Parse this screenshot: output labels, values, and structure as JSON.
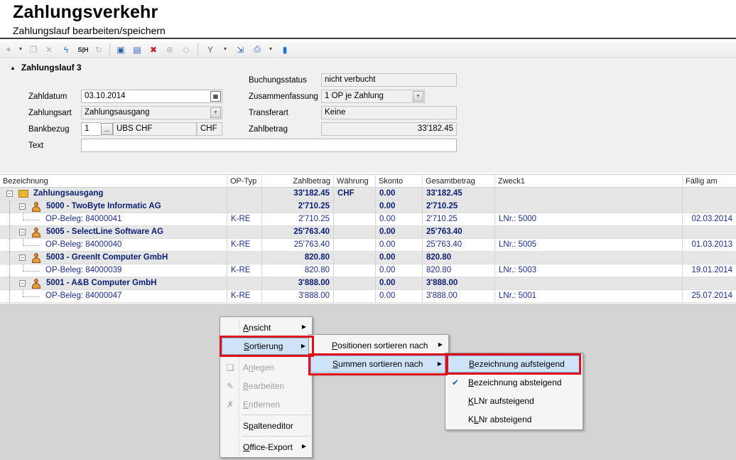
{
  "app": {
    "title": "Zahlungsverkehr",
    "subtitle": "Zahlungslauf bearbeiten/speichern"
  },
  "toolbar": {
    "icons": [
      "wand-icon",
      "copy-icon",
      "delete-icon",
      "lightning-icon",
      "sh-icon",
      "refresh-icon",
      "new-icon",
      "edit-icon",
      "remove-icon",
      "add-icon",
      "eraser-icon",
      "filter-icon",
      "export-icon",
      "print-icon",
      "save-icon"
    ],
    "sh_label": "S|H"
  },
  "section": {
    "title": "Zahlungslauf 3"
  },
  "form": {
    "zahldatum": {
      "label": "Zahldatum",
      "value": "03.10.2014"
    },
    "zahlungsart": {
      "label": "Zahlungsart",
      "value": "Zahlungsausgang"
    },
    "bankbezug": {
      "label": "Bankbezug",
      "value": "1",
      "bank": "UBS CHF",
      "currency": "CHF",
      "ellipsis": "..."
    },
    "text": {
      "label": "Text",
      "value": ""
    },
    "buchungsstatus": {
      "label": "Buchungsstatus",
      "value": "nicht verbucht"
    },
    "zusammenfassung": {
      "label": "Zusammenfassung",
      "value": "1 OP je Zahlung"
    },
    "transferart": {
      "label": "Transferart",
      "value": "Keine"
    },
    "zahlbetrag": {
      "label": "Zahlbetrag",
      "value": "33'182.45"
    }
  },
  "grid": {
    "columns": [
      "Bezeichnung",
      "OP-Typ",
      "Zahlbetrag",
      "Währung",
      "Skonto",
      "Gesamtbetrag",
      "Zweck1",
      "Fällig am"
    ],
    "rows": [
      {
        "kind": "root",
        "bezeichnung": "Zahlungsausgang",
        "optyp": "",
        "zahlbetrag": "33'182.45",
        "waehrung": "CHF",
        "skonto": "0.00",
        "gesamtbetrag": "33'182.45",
        "zweck1": "",
        "faellig": ""
      },
      {
        "kind": "group",
        "bezeichnung": "5000 - TwoByte Informatic AG",
        "optyp": "",
        "zahlbetrag": "2'710.25",
        "waehrung": "",
        "skonto": "0.00",
        "gesamtbetrag": "2'710.25",
        "zweck1": "",
        "faellig": ""
      },
      {
        "kind": "detail",
        "bezeichnung": "OP-Beleg: 84000041",
        "optyp": "K-RE",
        "zahlbetrag": "2'710.25",
        "waehrung": "",
        "skonto": "0.00",
        "gesamtbetrag": "2'710.25",
        "zweck1": "LNr.: 5000",
        "faellig": "02.03.2014"
      },
      {
        "kind": "group",
        "bezeichnung": "5005 - SelectLine Software AG",
        "optyp": "",
        "zahlbetrag": "25'763.40",
        "waehrung": "",
        "skonto": "0.00",
        "gesamtbetrag": "25'763.40",
        "zweck1": "",
        "faellig": ""
      },
      {
        "kind": "detail",
        "bezeichnung": "OP-Beleg: 84000040",
        "optyp": "K-RE",
        "zahlbetrag": "25'763.40",
        "waehrung": "",
        "skonto": "0.00",
        "gesamtbetrag": "25'763.40",
        "zweck1": "LNr.: 5005",
        "faellig": "01.03.2013"
      },
      {
        "kind": "group",
        "bezeichnung": "5003 - GreenIt Computer GmbH",
        "optyp": "",
        "zahlbetrag": "820.80",
        "waehrung": "",
        "skonto": "0.00",
        "gesamtbetrag": "820.80",
        "zweck1": "",
        "faellig": ""
      },
      {
        "kind": "detail",
        "bezeichnung": "OP-Beleg: 84000039",
        "optyp": "K-RE",
        "zahlbetrag": "820.80",
        "waehrung": "",
        "skonto": "0.00",
        "gesamtbetrag": "820.80",
        "zweck1": "LNr.: 5003",
        "faellig": "19.01.2014"
      },
      {
        "kind": "group",
        "bezeichnung": "5001 - A&B Computer GmbH",
        "optyp": "",
        "zahlbetrag": "3'888.00",
        "waehrung": "",
        "skonto": "0.00",
        "gesamtbetrag": "3'888.00",
        "zweck1": "",
        "faellig": ""
      },
      {
        "kind": "detail",
        "bezeichnung": "OP-Beleg: 84000047",
        "optyp": "K-RE",
        "zahlbetrag": "3'888.00",
        "waehrung": "",
        "skonto": "0.00",
        "gesamtbetrag": "3'888.00",
        "zweck1": "LNr.: 5001",
        "faellig": "25.07.2014"
      }
    ]
  },
  "context_menu": {
    "items": [
      {
        "label": "Ansicht",
        "u": "A",
        "rest": "nsicht",
        "submenu": true,
        "disabled": false
      },
      {
        "label": "Sortierung",
        "u": "S",
        "rest": "ortierung",
        "submenu": true,
        "disabled": false,
        "highlighted": true
      },
      {
        "label": "Anlegen",
        "u": "n",
        "pre": "A",
        "rest": "legen",
        "disabled": true,
        "icon": "new-doc-icon"
      },
      {
        "label": "Bearbeiten",
        "u": "B",
        "rest": "earbeiten",
        "disabled": true,
        "icon": "edit-doc-icon"
      },
      {
        "label": "Entfernen",
        "u": "E",
        "rest": "ntfernen",
        "disabled": true,
        "icon": "delete-doc-icon"
      },
      {
        "label": "Spalteneditor",
        "u": "p",
        "pre": "S",
        "rest": "alteneditor",
        "disabled": false
      },
      {
        "label": "Office-Export",
        "u": "O",
        "rest": "ffice-Export",
        "submenu": true,
        "disabled": false
      }
    ]
  },
  "submenu_sort": {
    "items": [
      {
        "label": "Positionen sortieren nach",
        "u": "P",
        "rest": "ositionen sortieren nach"
      },
      {
        "label": "Summen sortieren nach",
        "u": "S",
        "rest": "ummen sortieren nach",
        "highlighted": true
      }
    ]
  },
  "submenu_summen": {
    "items": [
      {
        "label": "Bezeichnung aufsteigend",
        "u": "B",
        "rest": "ezeichnung aufsteigend",
        "highlighted": true,
        "checked": false
      },
      {
        "label": "Bezeichnung absteigend",
        "u": "B",
        "rest": "ezeichnung absteigend",
        "checked": true
      },
      {
        "label": "KLNr aufsteigend",
        "u": "K",
        "rest": "LNr aufsteigend",
        "checked": false
      },
      {
        "label": "KLNr absteigend",
        "pre": "K",
        "u": "L",
        "rest": "Nr absteigend",
        "checked": false
      }
    ]
  },
  "colors": {
    "highlight_border": "#e0101a",
    "menu_highlight": "#cfe3f8",
    "row_text": "#0a1f72"
  }
}
